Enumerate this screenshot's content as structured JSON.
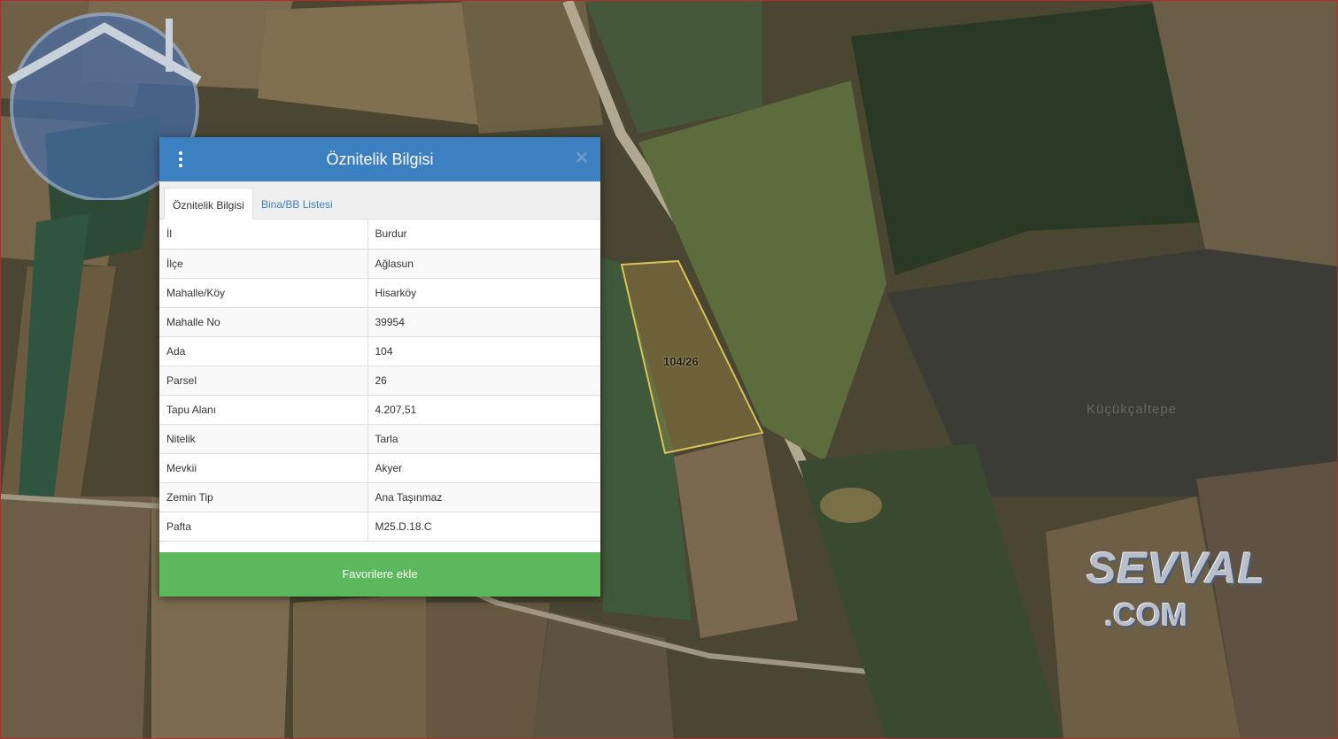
{
  "map": {
    "parcel_label": "104/26",
    "place_label": "Küçükçaltepe",
    "watermark_line1": "SEVVAL",
    "watermark_line2": ".COM"
  },
  "panel": {
    "title": "Öznitelik Bilgisi",
    "menu_icon": "vertical-dots-icon",
    "close_icon": "close-icon",
    "tabs": [
      {
        "label": "Öznitelik Bilgisi",
        "active": true
      },
      {
        "label": "Bina/BB Listesi",
        "active": false
      }
    ],
    "rows": [
      {
        "key": "İl",
        "value": "Burdur"
      },
      {
        "key": "İlçe",
        "value": "Ağlasun"
      },
      {
        "key": "Mahalle/Köy",
        "value": "Hisarköy"
      },
      {
        "key": "Mahalle No",
        "value": "39954"
      },
      {
        "key": "Ada",
        "value": "104"
      },
      {
        "key": "Parsel",
        "value": "26"
      },
      {
        "key": "Tapu Alanı",
        "value": "4.207,51"
      },
      {
        "key": "Nitelik",
        "value": "Tarla"
      },
      {
        "key": "Mevkii",
        "value": "Akyer"
      },
      {
        "key": "Zemin Tip",
        "value": "Ana Taşınmaz"
      },
      {
        "key": "Pafta",
        "value": "M25.D.18.C"
      }
    ],
    "favorite_button": "Favorilere ekle"
  },
  "colors": {
    "header": "#3d80c1",
    "tab_link": "#3d80c1",
    "favorite": "#5cb85c",
    "parcel_outline": "#d8c35a",
    "map_border": "#c0272d"
  }
}
